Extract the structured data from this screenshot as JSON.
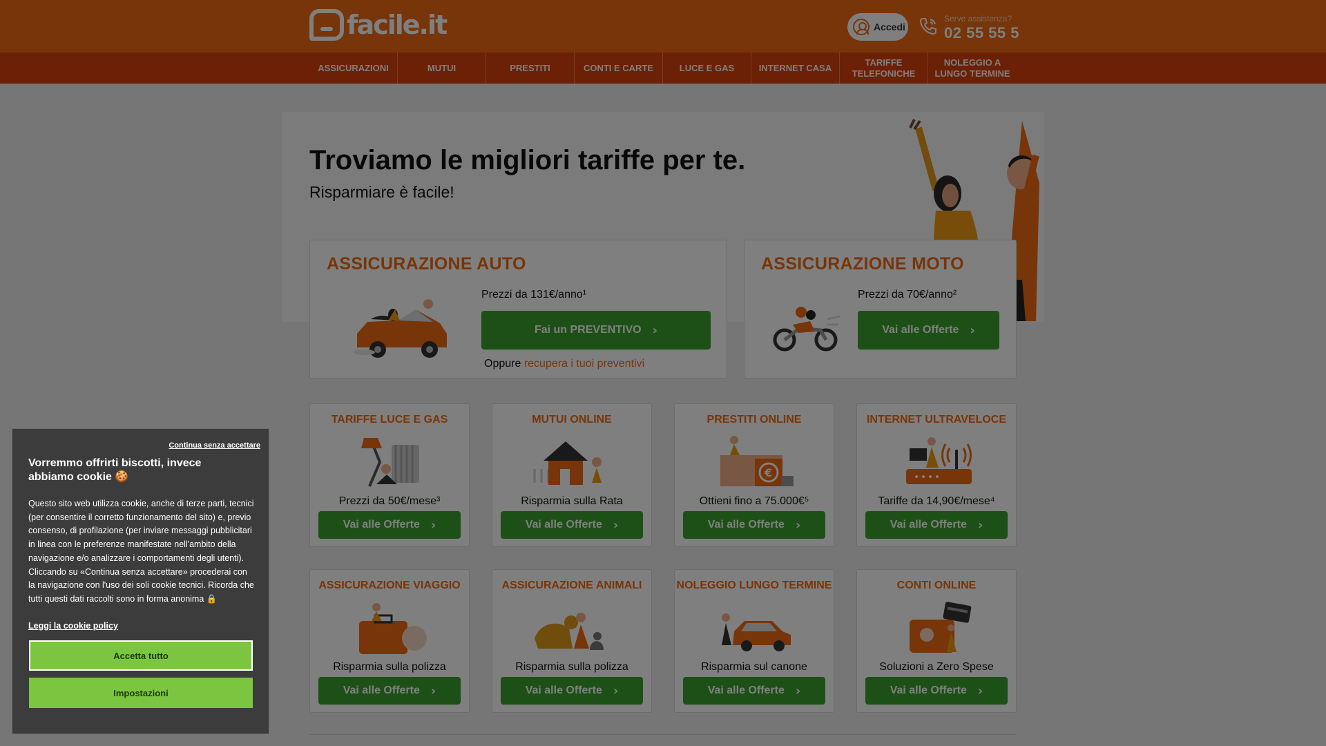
{
  "header": {
    "logo_text": "facile.it",
    "login_label": "Accedi",
    "assist_label": "Serve assistenza?",
    "assist_phone": "02 55 55 5"
  },
  "nav": {
    "items": [
      {
        "label": "ASSICURAZIONI"
      },
      {
        "label": "MUTUI"
      },
      {
        "label": "PRESTITI"
      },
      {
        "label": "CONTI E CARTE"
      },
      {
        "label": "LUCE E GAS"
      },
      {
        "label": "INTERNET CASA"
      },
      {
        "label": "TARIFFE TELEFONICHE"
      },
      {
        "label": "NOLEGGIO A LUNGO TERMINE"
      }
    ]
  },
  "hero": {
    "title": "Troviamo le migliori tariffe per te.",
    "subtitle": "Risparmiare è facile!"
  },
  "auto": {
    "title": "ASSICURAZIONE AUTO",
    "price": "Prezzi da 131€/anno¹",
    "button": "Fai un PREVENTIVO",
    "oppure": "Oppure",
    "recover_link": "recupera i tuoi preventivi"
  },
  "moto": {
    "title": "ASSICURAZIONE MOTO",
    "price": "Prezzi da 70€/anno²",
    "button": "Vai alle Offerte"
  },
  "cards": [
    {
      "title": "TARIFFE LUCE E GAS",
      "text": "Prezzi da 50€/mese³",
      "button": "Vai alle Offerte"
    },
    {
      "title": "MUTUI ONLINE",
      "text": "Risparmia sulla Rata",
      "button": "Vai alle Offerte"
    },
    {
      "title": "PRESTITI ONLINE",
      "text": "Ottieni fino a 75.000€⁵",
      "button": "Vai alle Offerte"
    },
    {
      "title": "INTERNET ULTRAVELOCE",
      "text": "Tariffe da 14,90€/mese⁴",
      "button": "Vai alle Offerte"
    },
    {
      "title": "ASSICURAZIONE VIAGGIO",
      "text": "Risparmia sulla polizza",
      "button": "Vai alle Offerte"
    },
    {
      "title": "ASSICURAZIONE ANIMALI",
      "text": "Risparmia sulla polizza",
      "button": "Vai alle Offerte"
    },
    {
      "title": "NOLEGGIO LUNGO TERMINE",
      "text": "Risparmia sul canone",
      "button": "Vai alle Offerte"
    },
    {
      "title": "CONTI ONLINE",
      "text": "Soluzioni a Zero Spese",
      "button": "Vai alle Offerte"
    }
  ],
  "cookie": {
    "skip": "Continua senza accettare",
    "title": "Vorremmo offrirti biscotti, invece abbiamo cookie 🍪",
    "body": "Questo sito web utilizza cookie, anche di terze parti, tecnici (per consentire il corretto funzionamento del sito) e, previo consenso, di profilazione (per inviare messaggi pubblicitari in linea con le preferenze manifestate nell'ambito della navigazione e/o analizzare i comportamenti degli utenti). Cliccando su «Continua senza accettare» procederai con la navigazione con l'uso dei soli cookie tecnici. Ricorda che tutti questi dati raccolti sono in forma anonima 🔒",
    "policy_link": "Leggi la cookie policy",
    "accept": "Accetta tutto",
    "settings": "Impostazioni"
  },
  "colors": {
    "brand_orange": "#ee6a12",
    "nav_red": "#d8400b",
    "button_green": "#3aa02e",
    "cookie_green": "#7cc540"
  }
}
